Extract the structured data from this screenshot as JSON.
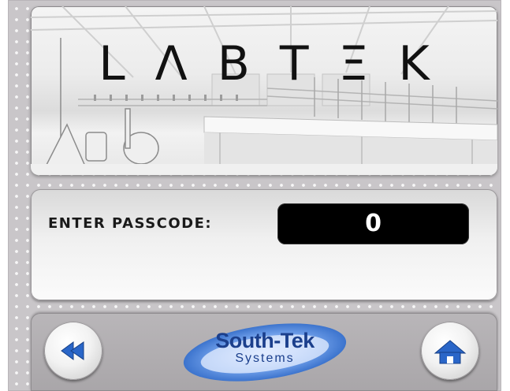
{
  "header": {
    "logo_text": "LΛBTΞK"
  },
  "passcode": {
    "label": "ENTER PASSCODE:",
    "value": "0"
  },
  "footer": {
    "brand_name": "South-Tek",
    "brand_sub": "Systems",
    "back_icon": "rewind-double-arrow-icon",
    "home_icon": "home-icon"
  },
  "colors": {
    "brand_blue": "#1b3f8c",
    "button_blue": "#1f5bbd",
    "field_black": "#000000"
  }
}
